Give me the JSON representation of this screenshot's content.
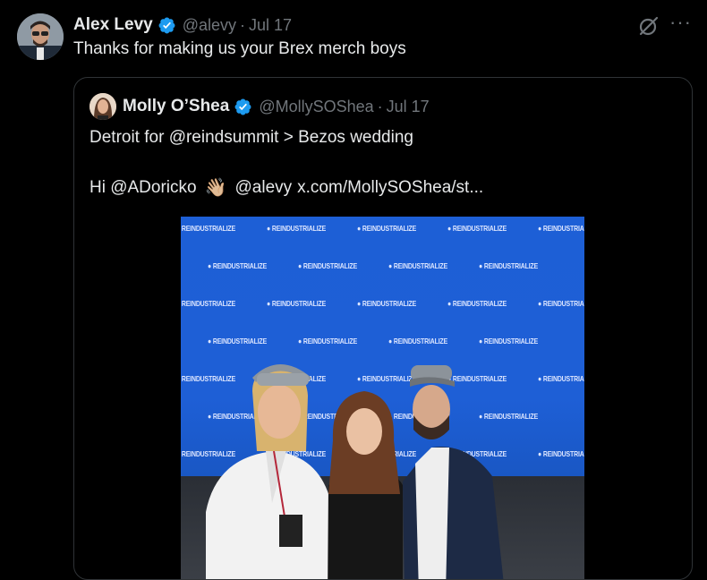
{
  "tweet": {
    "author_name": "Alex Levy",
    "author_handle": "@alevy",
    "separator": "·",
    "date": "Jul 17",
    "text": "Thanks for making us your Brex merch boys",
    "more_label": "···"
  },
  "quote": {
    "author_name": "Molly O’Shea",
    "author_handle": "@MollySOShea",
    "separator": "·",
    "date": "Jul 17",
    "line1": "Detroit for @reindsummit > Bezos wedding",
    "line2_part1": "Hi @ADoricko",
    "line2_emoji": "👋🏼",
    "line2_part2": "@alevy",
    "line2_link": "x.com/MollySOShea/st...",
    "backdrop_word": "REINDUSTRIALIZE"
  },
  "colors": {
    "background": "#000000",
    "text_primary": "#e7e9ea",
    "text_secondary": "#71767b",
    "verified_blue": "#1d9bf0",
    "border": "#2f3336",
    "backdrop_blue": "#1e5fd6"
  },
  "icons": [
    "verified-badge-icon",
    "grok-icon",
    "more-icon",
    "wave-emoji"
  ]
}
